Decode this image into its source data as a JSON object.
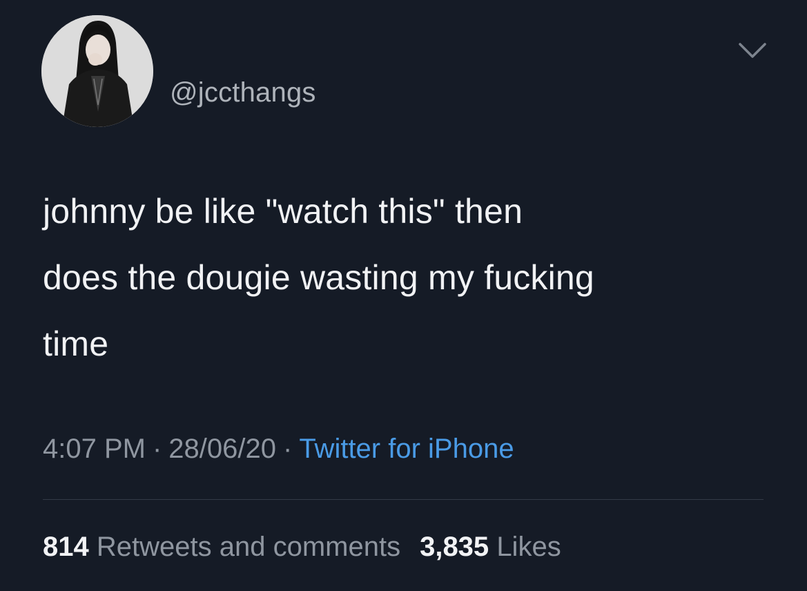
{
  "tweet": {
    "handle": "@jccthangs",
    "text": "johnny be like \"watch this\" then\ndoes the dougie wasting my fucking\ntime",
    "time": "4:07 PM",
    "date": "28/06/20",
    "separator": "·",
    "source": "Twitter for iPhone",
    "retweets_count": "814",
    "retweets_label": "Retweets and comments",
    "likes_count": "3,835",
    "likes_label": "Likes"
  },
  "icons": {
    "menu": "chevron-down-icon",
    "avatar": "profile-avatar"
  },
  "colors": {
    "background": "#151b26",
    "primary_text": "#f1f2f4",
    "secondary_text": "#8f96a0",
    "link": "#4a9be6",
    "divider": "#343b47"
  }
}
